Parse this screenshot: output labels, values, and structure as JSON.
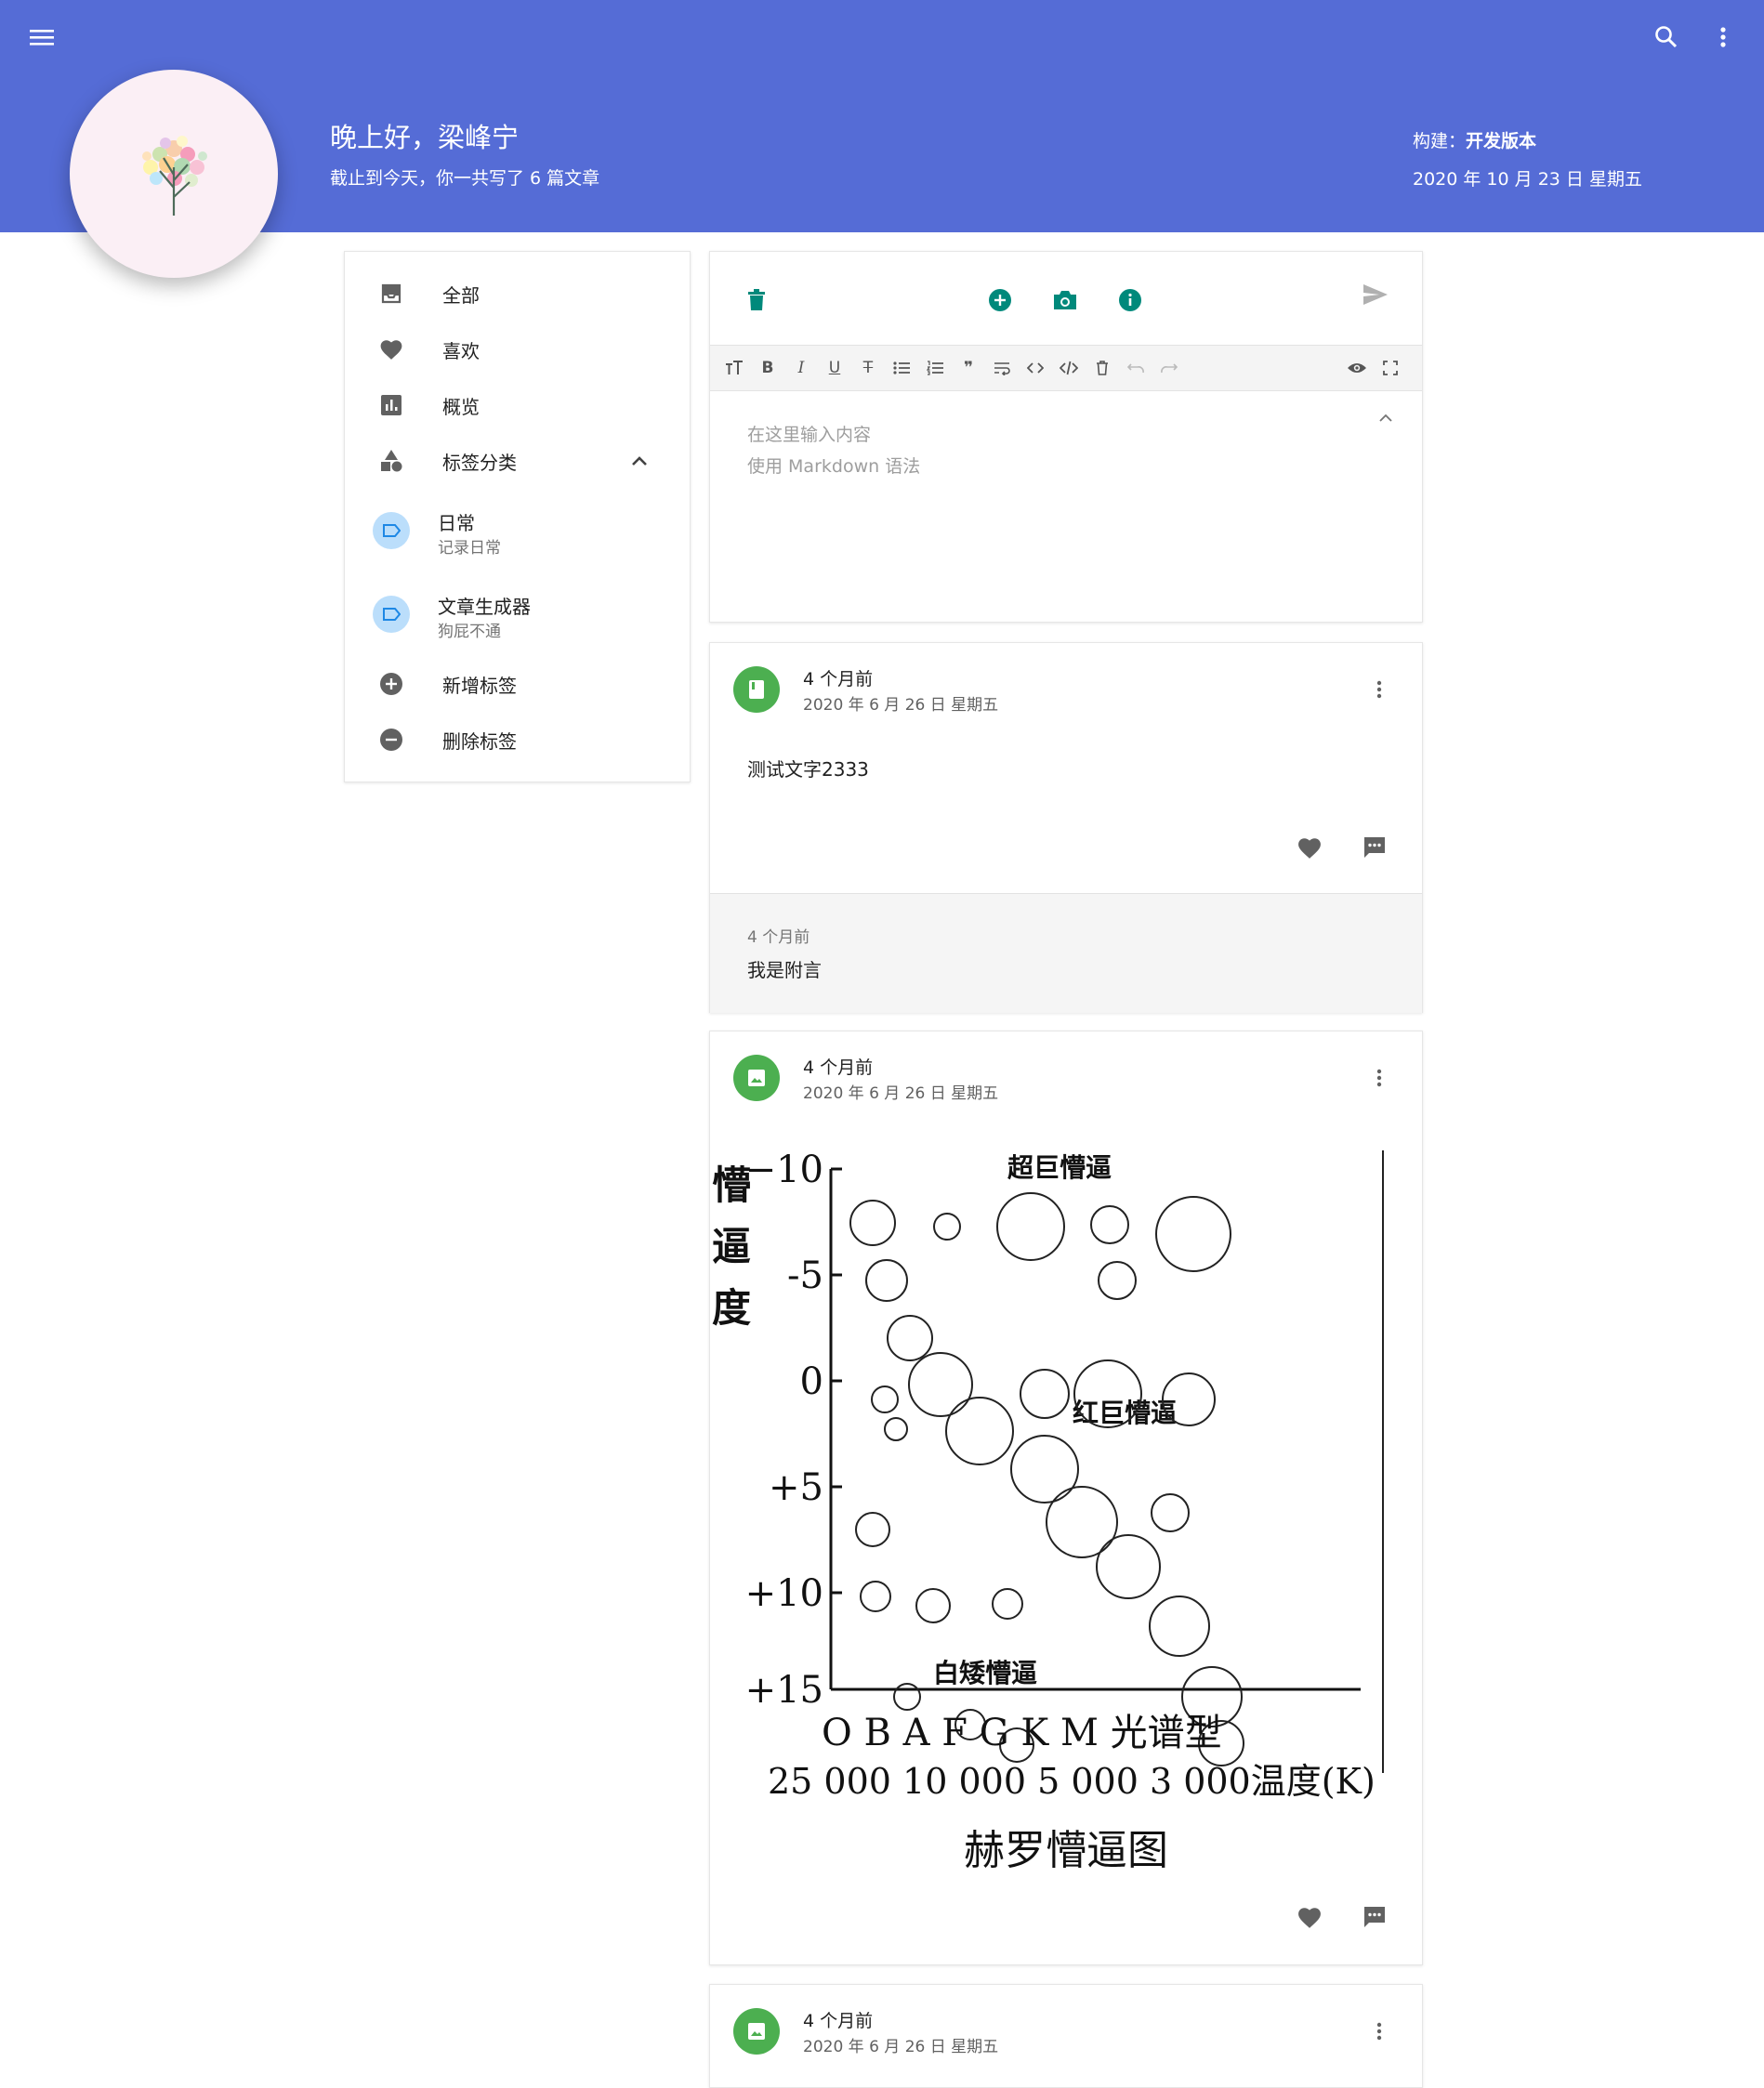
{
  "header": {
    "greeting": "晚上好，梁峰宁",
    "summary": "截止到今天，你一共写了 6 篇文章",
    "build_label": "构建：",
    "build_value": "开发版本",
    "date": "2020 年 10 月 23 日 星期五",
    "icons": [
      "menu-icon",
      "search-icon",
      "more-vert-icon"
    ]
  },
  "nav": {
    "items": [
      {
        "label": "全部",
        "icon": "inbox-icon"
      },
      {
        "label": "喜欢",
        "icon": "heart-icon"
      },
      {
        "label": "概览",
        "icon": "chart-icon"
      },
      {
        "label": "标签分类",
        "icon": "shapes-icon"
      }
    ],
    "tags": [
      {
        "name": "日常",
        "desc": "记录日常"
      },
      {
        "name": "文章生成器",
        "desc": "狗屁不通"
      }
    ],
    "actions": [
      {
        "label": "新增标签",
        "icon": "add-circle-icon"
      },
      {
        "label": "删除标签",
        "icon": "remove-circle-icon"
      }
    ]
  },
  "editor": {
    "placeholder": "在这里输入内容\n使用 Markdown 语法",
    "toolbar": [
      "heading",
      "bold",
      "italic",
      "underline",
      "strikethrough",
      "bullet-list",
      "ordered-list",
      "quote",
      "wrap",
      "code",
      "code-block",
      "delete",
      "undo",
      "redo",
      "preview",
      "fullscreen"
    ],
    "accent_color": "#00897b"
  },
  "posts": [
    {
      "relative": "4 个月前",
      "date": "2020 年 6 月 26 日 星期五",
      "content": "测试文字2333",
      "note_time": "4 个月前",
      "note_text": "我是附言"
    },
    {
      "relative": "4 个月前",
      "date": "2020 年 6 月 26 日 星期五"
    },
    {
      "relative": "4 个月前",
      "date": "2020 年 6 月 26 日 星期五"
    }
  ],
  "image_post": {
    "yaxis_title": [
      "懵",
      "逼",
      "度"
    ],
    "yticks": [
      "−10",
      "-5",
      "0",
      "+5",
      "+10",
      "+15"
    ],
    "spectral_types": "O  B  A  F  G  K  M  光谱型",
    "temperatures": "25 000 10 000 5 000 3 000温度(K)",
    "caption": "赫罗懵逼图",
    "region_labels": [
      "超巨懵逼",
      "红巨懵逼",
      "白矮懵逼"
    ]
  },
  "colors": {
    "appbar": "#556cd6",
    "avatar_bg": "#fbeff5",
    "post_icon": "#4caf50",
    "tag_bg": "#bbdefb"
  }
}
